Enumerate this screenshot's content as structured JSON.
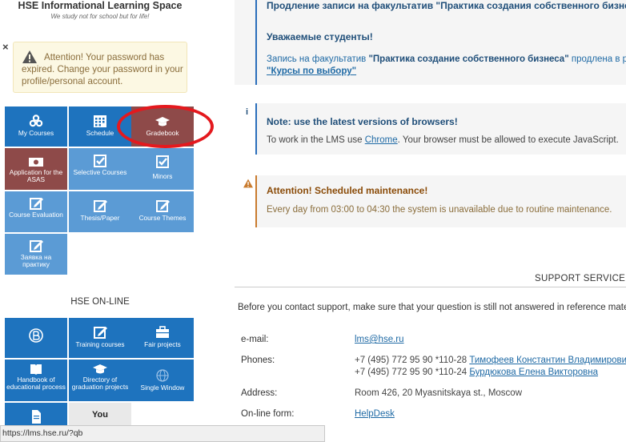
{
  "header": {
    "site_title": "HSE Informational Learning Space",
    "motto": "We study not for school but for life!"
  },
  "alert": {
    "close": "×",
    "text": "Attention! Your password has expired. Change your password in your profile/personal account."
  },
  "tiles": [
    {
      "label": "My Courses",
      "icon": "cubes-icon"
    },
    {
      "label": "Schedule",
      "icon": "calendar-icon"
    },
    {
      "label": "Gradebook",
      "icon": "graduation-cap-icon"
    },
    {
      "label": "Application for the ASAS",
      "icon": "money-icon"
    },
    {
      "label": "Selective Courses",
      "icon": "checkbox-icon"
    },
    {
      "label": "Minors",
      "icon": "checkbox-icon"
    },
    {
      "label": "Course Evaluation",
      "icon": "edit-icon"
    },
    {
      "label": "Thesis/Paper",
      "icon": "edit-icon"
    },
    {
      "label": "Course Themes",
      "icon": "edit-icon"
    },
    {
      "label": "Заявка на практику",
      "icon": "edit-icon"
    }
  ],
  "online": {
    "title": "HSE ON-LINE",
    "tiles": [
      {
        "label": "",
        "icon": "hse-logo-icon"
      },
      {
        "label": "Training courses",
        "icon": "edit-icon"
      },
      {
        "label": "Fair projects",
        "icon": "briefcase-icon"
      },
      {
        "label": "Handbook of educational process",
        "icon": "book-icon"
      },
      {
        "label": "Directory of graduation projects",
        "icon": "graduation-cap-icon"
      },
      {
        "label": "Single Window",
        "icon": "globe-icon"
      },
      {
        "label": "",
        "icon": "document-icon"
      },
      {
        "label": "You",
        "icon": "youtube-icon"
      }
    ]
  },
  "announcements": {
    "a1": {
      "title": "Продление записи на факультатив \"Практика создания собственного бизнеса\"",
      "greeting": "Уважаемые студенты!",
      "text_pre": "Запись на факультатив ",
      "text_bold": "\"Практика создание собственного бизнеса\"",
      "text_post": " продлена в разделе",
      "link": "\"Курсы по выбору\""
    },
    "a2": {
      "icon_char": "i",
      "title": "Note: use the latest versions of browsers!",
      "text_pre": "To work in the LMS use ",
      "link": "Chrome",
      "text_post": ". Your browser must be allowed to execute JavaScript."
    },
    "a3": {
      "title": "Attention! Scheduled maintenance!",
      "text": "Every day from 03:00 to 04:30 the system is unavailable due to routine maintenance."
    }
  },
  "support": {
    "heading": "SUPPORT SERVICE",
    "intro": "Before you contact support, make sure that your question is still not answered in reference materials.",
    "email_label": "e-mail:",
    "email": "lms@hse.ru",
    "phones_label": "Phones:",
    "phone1": "+7 (495) 772 95 90 *110-28 ",
    "phone1_name": "Тимофеев Константин Владимирович",
    "phone2": "+7 (495) 772 95 90 *110-24 ",
    "phone2_name": "Бурдюкова Елена Викторовна",
    "address_label": "Address:",
    "address": "Room 426, 20 Myasnitskaya st., Moscow",
    "form_label": "On-line form:",
    "form_link": "HelpDesk"
  },
  "status_bar": {
    "url": "https://lms.hse.ru/?qb"
  },
  "colors": {
    "tile_blue": "#1e73be",
    "tile_light_blue": "#5b9bd5",
    "tile_active": "#8e4a49",
    "highlight": "#e4191e"
  }
}
